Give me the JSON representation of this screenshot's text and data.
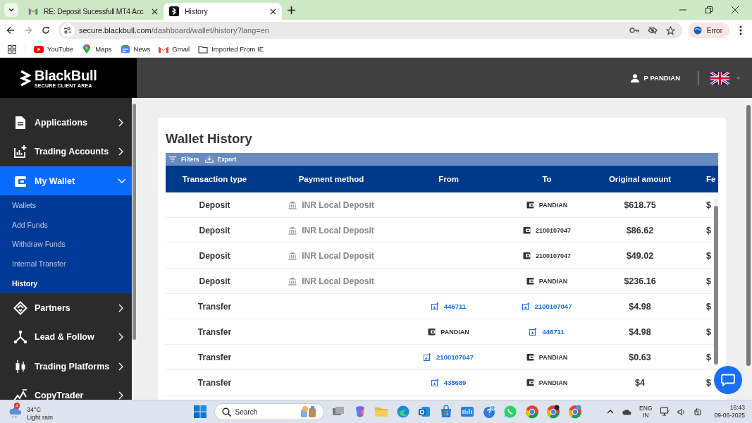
{
  "browser": {
    "tabs": [
      {
        "title": "RE: Deposit Sucessfull MT4 Acc",
        "selected": false
      },
      {
        "title": "History",
        "selected": true
      }
    ],
    "address": {
      "host": "secure.blackbull.com",
      "path": "/dashboard/wallet/history?lang=en"
    },
    "profile_button": "Error",
    "bookmarks": [
      "YouTube",
      "Maps",
      "News",
      "Gmail",
      "Imported From IE"
    ]
  },
  "header": {
    "brand": "BlackBull",
    "tagline": "SECURE CLIENT AREA",
    "user": "P PANDIAN"
  },
  "sidebar": {
    "items": [
      {
        "label": "Applications",
        "selected": false,
        "expanded": false
      },
      {
        "label": "Trading Accounts",
        "selected": false,
        "expanded": false
      },
      {
        "label": "My Wallet",
        "selected": true,
        "expanded": true,
        "children": [
          {
            "label": "Wallets",
            "selected": false
          },
          {
            "label": "Add Funds",
            "selected": false
          },
          {
            "label": "Withdraw Funds",
            "selected": false
          },
          {
            "label": "Internal Transfer",
            "selected": false
          },
          {
            "label": "History",
            "selected": true
          }
        ]
      },
      {
        "label": "Partners",
        "selected": false,
        "expanded": false
      },
      {
        "label": "Lead & Follow",
        "selected": false,
        "expanded": false
      },
      {
        "label": "Trading Platforms",
        "selected": false,
        "expanded": false
      },
      {
        "label": "CopyTrader",
        "selected": false,
        "expanded": false
      }
    ]
  },
  "page": {
    "title": "Wallet History",
    "toolbar": [
      "Filters",
      "Export"
    ],
    "table": {
      "columns": [
        "Transaction type",
        "Payment method",
        "From",
        "To",
        "Original amount",
        "Fe"
      ],
      "rows": [
        {
          "type": "Deposit",
          "method": "INR Local Deposit",
          "to": {
            "kind": "wallet",
            "text": "PANDIAN"
          },
          "amount": "$618.75",
          "fee": "$"
        },
        {
          "type": "Deposit",
          "method": "INR Local Deposit",
          "to": {
            "kind": "wallet",
            "text": "2100107047"
          },
          "amount": "$86.62",
          "fee": "$"
        },
        {
          "type": "Deposit",
          "method": "INR Local Deposit",
          "to": {
            "kind": "wallet",
            "text": "2100107047"
          },
          "amount": "$49.02",
          "fee": "$"
        },
        {
          "type": "Deposit",
          "method": "INR Local Deposit",
          "to": {
            "kind": "wallet",
            "text": "PANDIAN"
          },
          "amount": "$236.16",
          "fee": "$"
        },
        {
          "type": "Transfer",
          "from": {
            "kind": "account",
            "text": "446711"
          },
          "to": {
            "kind": "account",
            "text": "2100107047"
          },
          "amount": "$4.98",
          "fee": "$"
        },
        {
          "type": "Transfer",
          "from": {
            "kind": "wallet",
            "text": "PANDIAN"
          },
          "to": {
            "kind": "account",
            "text": "446711"
          },
          "amount": "$4.98",
          "fee": "$"
        },
        {
          "type": "Transfer",
          "from": {
            "kind": "account",
            "text": "2100107047"
          },
          "to": {
            "kind": "wallet",
            "text": "PANDIAN"
          },
          "amount": "$0.63",
          "fee": "$"
        },
        {
          "type": "Transfer",
          "from": {
            "kind": "account",
            "text": "438689"
          },
          "to": {
            "kind": "wallet",
            "text": "PANDIAN"
          },
          "amount": "$4",
          "fee": "$"
        }
      ]
    }
  },
  "taskbar": {
    "weather": {
      "badge": "4",
      "temperature": "34°C",
      "condition": "Light rain"
    },
    "search_placeholder": "Search",
    "language": [
      "ENG",
      "IN"
    ],
    "time": "16:43",
    "date": "09-06-2025"
  }
}
